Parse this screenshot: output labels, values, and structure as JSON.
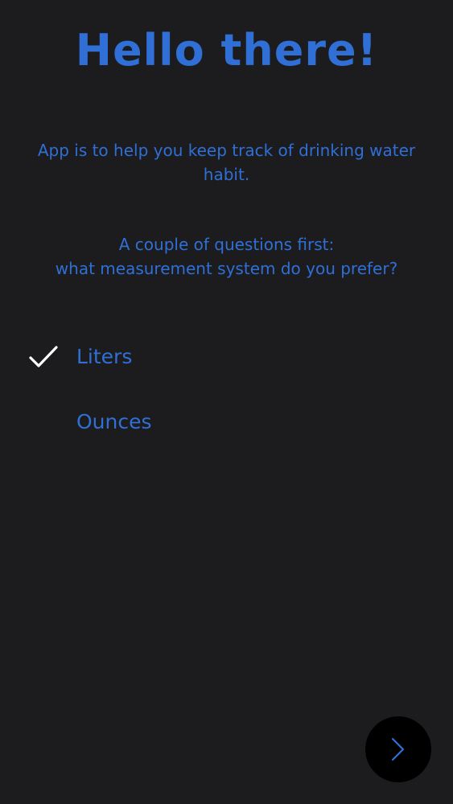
{
  "header": {
    "title": "Hello there!"
  },
  "intro": {
    "text": "App is to help you keep track of drinking water habit."
  },
  "question": {
    "line1": "A couple of questions first:",
    "line2": "what measurement system do you prefer?"
  },
  "options": [
    {
      "label": "Liters",
      "selected": true
    },
    {
      "label": "Ounces",
      "selected": false
    }
  ],
  "next_button": {
    "icon": "chevron-right-icon"
  },
  "colors": {
    "background": "#1c1c1e",
    "accent": "#2f6fd6",
    "check": "#ffffff",
    "button": "#000000"
  }
}
